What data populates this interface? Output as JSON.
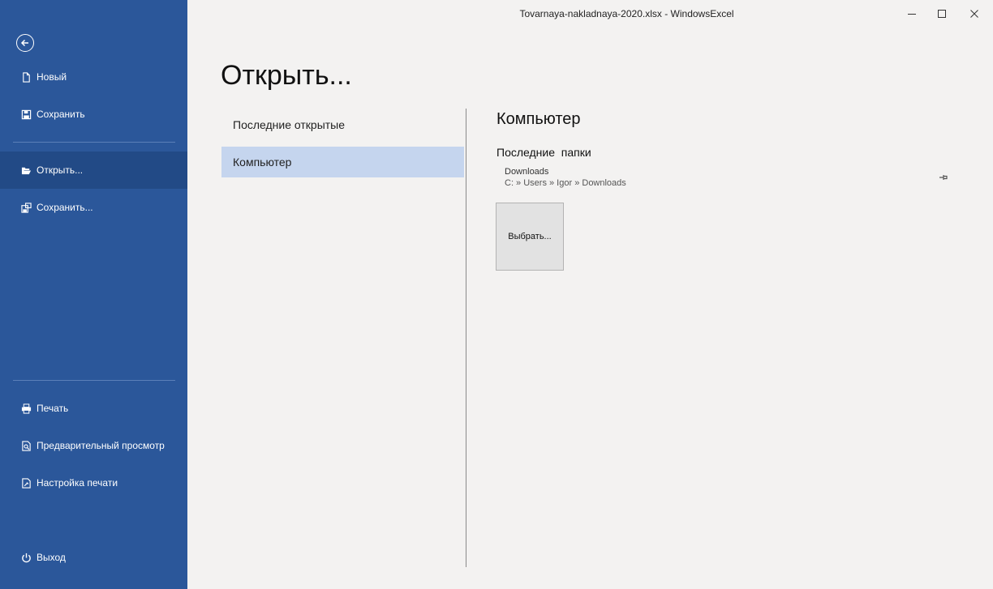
{
  "window": {
    "title": "Tovarnaya-nakladnaya-2020.xlsx - WindowsExcel",
    "controls": [
      "minimize-icon",
      "maximize-icon",
      "close-icon"
    ]
  },
  "sidebar": {
    "back_icon": "back-arrow-icon",
    "items": [
      {
        "label": "Новый",
        "icon": "new-document-icon"
      },
      {
        "label": "Сохранить",
        "icon": "save-icon"
      },
      {
        "label": "Открыть...",
        "icon": "open-folder-icon",
        "active": true
      },
      {
        "label": "Сохранить...",
        "icon": "save-as-icon"
      },
      {
        "label": "Печать",
        "icon": "print-icon"
      },
      {
        "label": "Предварительный просмотр",
        "icon": "print-preview-icon"
      },
      {
        "label": "Настройка печати",
        "icon": "print-settings-icon"
      },
      {
        "label": "Выход",
        "icon": "power-icon"
      }
    ]
  },
  "main": {
    "title": "Открыть...",
    "locations": [
      {
        "label": "Последние открытые",
        "selected": false
      },
      {
        "label": "Компьютер",
        "selected": true
      }
    ],
    "right": {
      "title": "Компьютер",
      "recent_folders_label": "Последние  папки",
      "folders": [
        {
          "name": "Downloads",
          "path": "C: » Users » Igor » Downloads"
        }
      ],
      "browse_label": "Выбрать..."
    }
  },
  "colors": {
    "sidebar": "#2b579a",
    "sidebar_active": "#224a86",
    "selected_location": "#c5d5ee",
    "background": "#f3f2f1"
  }
}
